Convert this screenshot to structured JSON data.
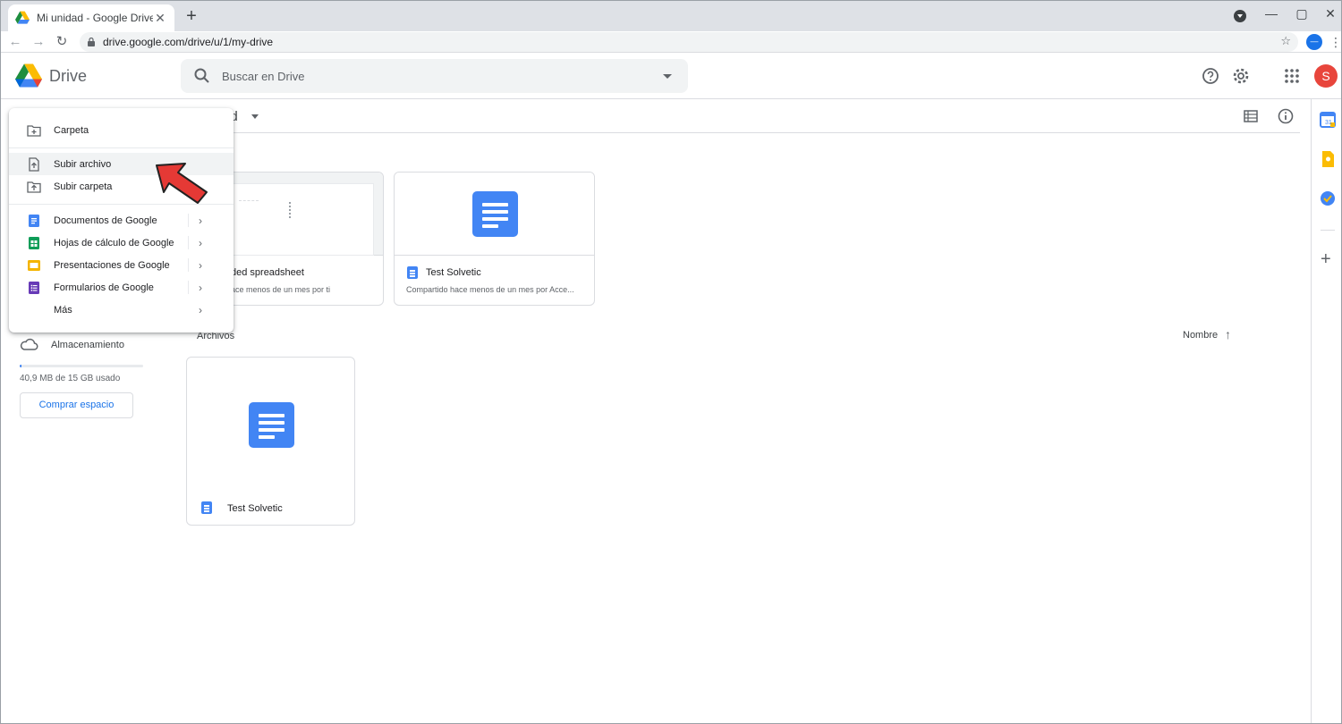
{
  "browser": {
    "tab_title": "Mi unidad - Google Drive",
    "tab_close": "✕",
    "new_tab": "+",
    "url": "drive.google.com/drive/u/1/my-drive",
    "window_controls": [
      "—",
      "▢",
      "✕"
    ],
    "nav_back": "←",
    "nav_forward": "→",
    "nav_reload": "↻",
    "star": "☆",
    "account_badge": "—",
    "menu": "⋮"
  },
  "drive_header": {
    "app_name": "Drive",
    "search_placeholder": "Buscar en Drive",
    "avatar_letter": "S",
    "icons": [
      "help-icon",
      "settings-icon",
      "apps-grid-icon"
    ]
  },
  "subbar": {
    "breadcrumb_fragment": "ad"
  },
  "new_menu": {
    "items": [
      {
        "label": "Carpeta",
        "icon": "new-folder-icon"
      },
      {
        "label": "Subir archivo",
        "icon": "file-upload-icon"
      },
      {
        "label": "Subir carpeta",
        "icon": "folder-upload-icon"
      },
      {
        "label": "Documentos de Google",
        "icon": "google-docs-icon",
        "submenu": true
      },
      {
        "label": "Hojas de cálculo de Google",
        "icon": "google-sheets-icon",
        "submenu": true
      },
      {
        "label": "Presentaciones de Google",
        "icon": "google-slides-icon",
        "submenu": true
      },
      {
        "label": "Formularios de Google",
        "icon": "google-forms-icon",
        "submenu": true
      },
      {
        "label": "Más",
        "submenu": true
      }
    ],
    "chevron": "›"
  },
  "quick_access": [
    {
      "title": "ded spreadsheet",
      "subtitle": "ace menos de un mes por ti"
    },
    {
      "title": "Test Solvetic",
      "subtitle": "Compartido hace menos de un mes por Acce..."
    }
  ],
  "files_section": {
    "label": "Archivos",
    "sort_label": "Nombre",
    "sort_arrow": "↑",
    "files": [
      {
        "title": "Test Solvetic"
      }
    ]
  },
  "storage": {
    "label": "Almacenamiento",
    "usage_text": "40,9 MB de 15 GB usado",
    "used_fraction": 0.003,
    "buy_button": "Comprar espacio"
  },
  "colors": {
    "accent": "#1a73e8",
    "docs_blue": "#4285f4",
    "sheets_green": "#0f9d58",
    "slides_yellow": "#f4b400",
    "forms_purple": "#673ab7",
    "avatar_red": "#e8453c",
    "pointer_red": "#e53935"
  }
}
